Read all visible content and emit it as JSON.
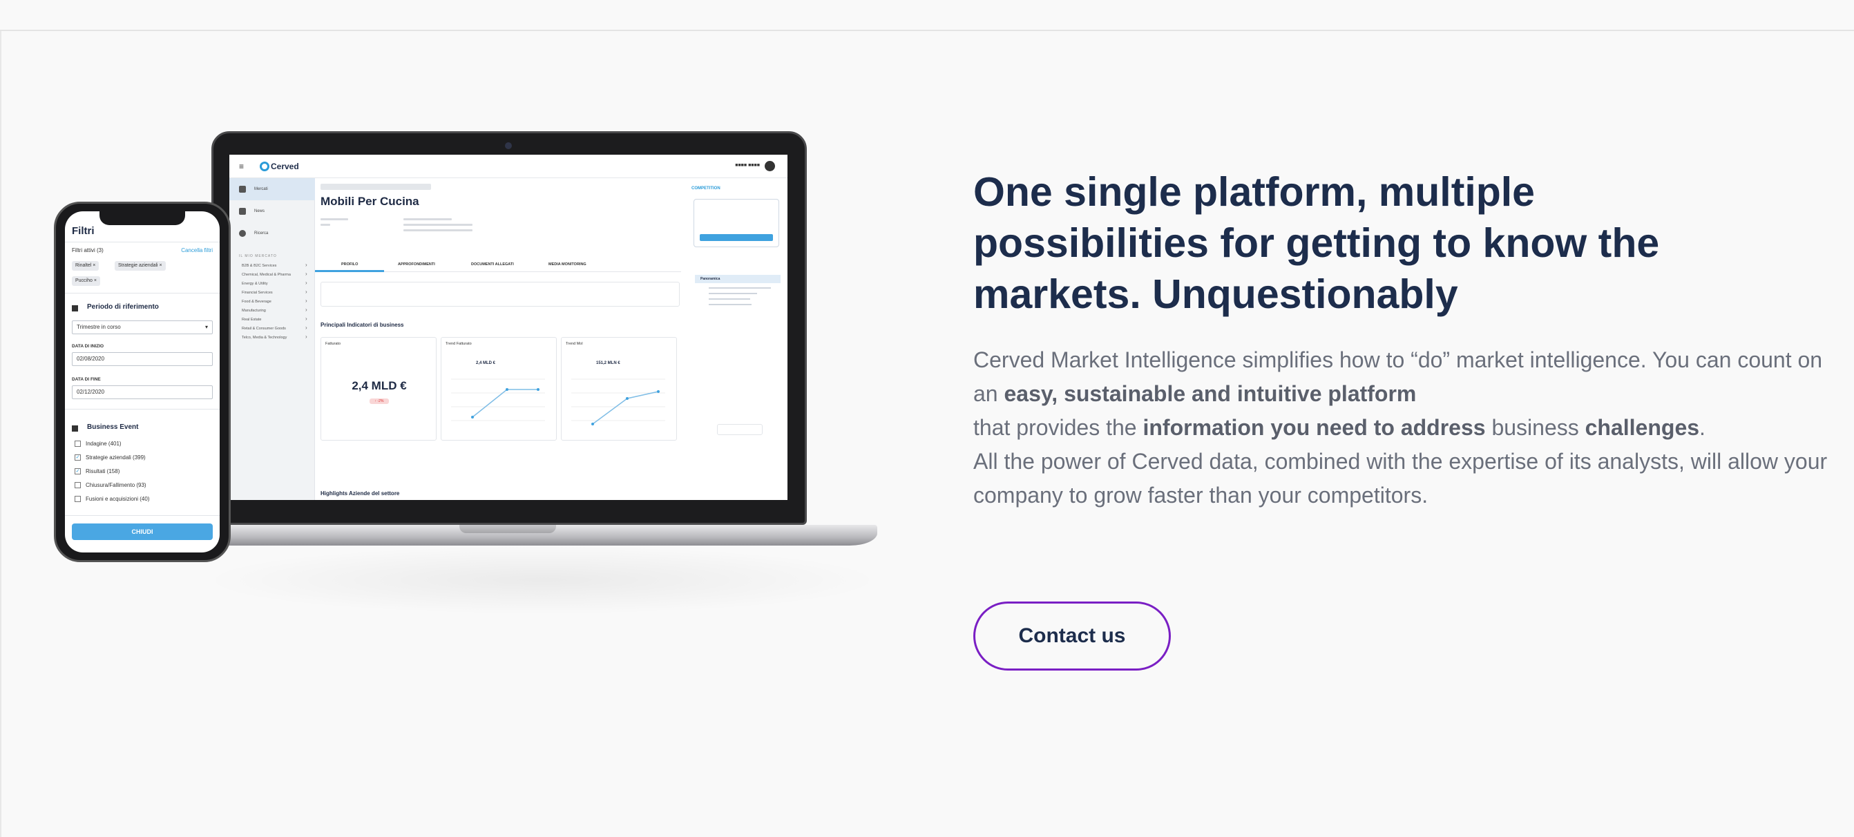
{
  "headline": {
    "line1": "One single platform, multiple",
    "line2": "possibilities for getting to know the",
    "line3": "markets. Unquestionably"
  },
  "body": {
    "t1": "Cerved Market Intelligence simplifies how to “do” market intelligence. You can count on an ",
    "b1": "easy, sustainable and intuitive platform",
    "t2": "that provides the ",
    "b2": "information you need to address",
    "t3": " business ",
    "b3": "challenges",
    "t4": ".",
    "t5": "All the power of Cerved data, combined with the expertise of its analysts, will allow your company to grow faster than your competitors."
  },
  "cta": {
    "label": "Contact us"
  },
  "colors": {
    "heading": "#1d2d4c",
    "body": "#6a6f7b",
    "cta_border": "#7a1fc4",
    "accent": "#3fa2df"
  },
  "laptop_app": {
    "logo": "Cerved",
    "page_title": "Mobili Per Cucina",
    "competition_link": "COMPETITION",
    "tabs": [
      "PROFILO",
      "APPROFONDIMENTI",
      "DOCUMENTI ALLEGATI",
      "MEDIA MONITORING"
    ],
    "section_kpi": "Principali Indicatori di business",
    "section_highlights": "Highlights Aziende del settore",
    "kpi_card_label": "Fatturato",
    "kpi_value": "2,4 MLD €",
    "kpi_delta": "↑ -2%",
    "trend1_label": "Trend Fatturato",
    "trend1_value": "2,4 MLD €",
    "trend2_label": "Trend Mol",
    "trend2_value": "151,2 MLN €",
    "panel_title": "Panoramica",
    "sidebar": [
      "Mercati",
      "News",
      "Ricerca"
    ],
    "sidebar_section": "IL MIO MERCATO",
    "sidebar_sub": [
      "B2B & B2C Services",
      "Chemical, Medical & Pharma",
      "Energy & Utility",
      "Financial Services",
      "Food & Beverage",
      "Manufacturing",
      "Real Estate",
      "Retail & Consumer Goods",
      "Telco, Media & Technology"
    ]
  },
  "phone_app": {
    "title": "Filtri",
    "active_filters": "Filtri attivi (3)",
    "clear_link": "Cancella filtri",
    "chips": [
      "Rinaltel ×",
      "Strategie aziendali ×",
      "Pucciho ×"
    ],
    "period_title": "Periodo di riferimento",
    "period_select": "Trimestre in corso",
    "start_label": "DATA DI INIZIO",
    "start_value": "02/08/2020",
    "end_label": "DATA DI FINE",
    "end_value": "02/12/2020",
    "event_title": "Business Event",
    "events": [
      "Indagine (401)",
      "Strategie aziendali (399)",
      "Risultati (158)",
      "Chiusura/Fallimento (93)",
      "Fusioni e acquisizioni (40)"
    ],
    "events_checked": [
      false,
      true,
      true,
      false,
      false
    ],
    "apply_button": "CHIUDI"
  }
}
